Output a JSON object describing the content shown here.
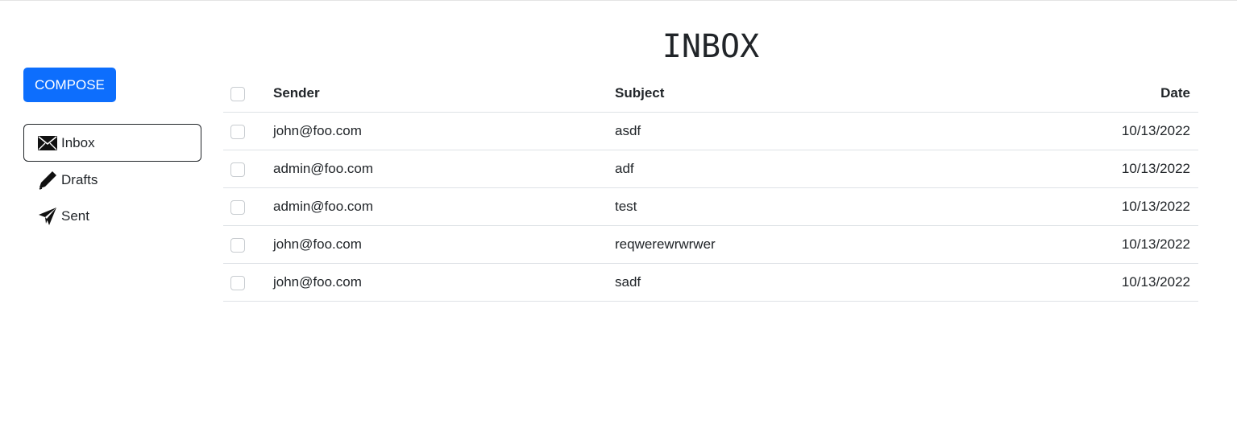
{
  "sidebar": {
    "compose_label": "COMPOSE",
    "items": [
      {
        "label": "Inbox",
        "icon": "envelope-icon",
        "active": true
      },
      {
        "label": "Drafts",
        "icon": "pencil-icon",
        "active": false
      },
      {
        "label": "Sent",
        "icon": "paper-plane-icon",
        "active": false
      }
    ]
  },
  "main": {
    "title": "INBOX",
    "columns": {
      "sender": "Sender",
      "subject": "Subject",
      "date": "Date"
    },
    "rows": [
      {
        "sender": "john@foo.com",
        "subject": "asdf",
        "date": "10/13/2022"
      },
      {
        "sender": "admin@foo.com",
        "subject": "adf",
        "date": "10/13/2022"
      },
      {
        "sender": "admin@foo.com",
        "subject": "test",
        "date": "10/13/2022"
      },
      {
        "sender": "john@foo.com",
        "subject": "reqwerewrwrwer",
        "date": "10/13/2022"
      },
      {
        "sender": "john@foo.com",
        "subject": "sadf",
        "date": "10/13/2022"
      }
    ]
  },
  "colors": {
    "accent": "#0d6efd",
    "text": "#212529",
    "border": "#dee2e6"
  }
}
